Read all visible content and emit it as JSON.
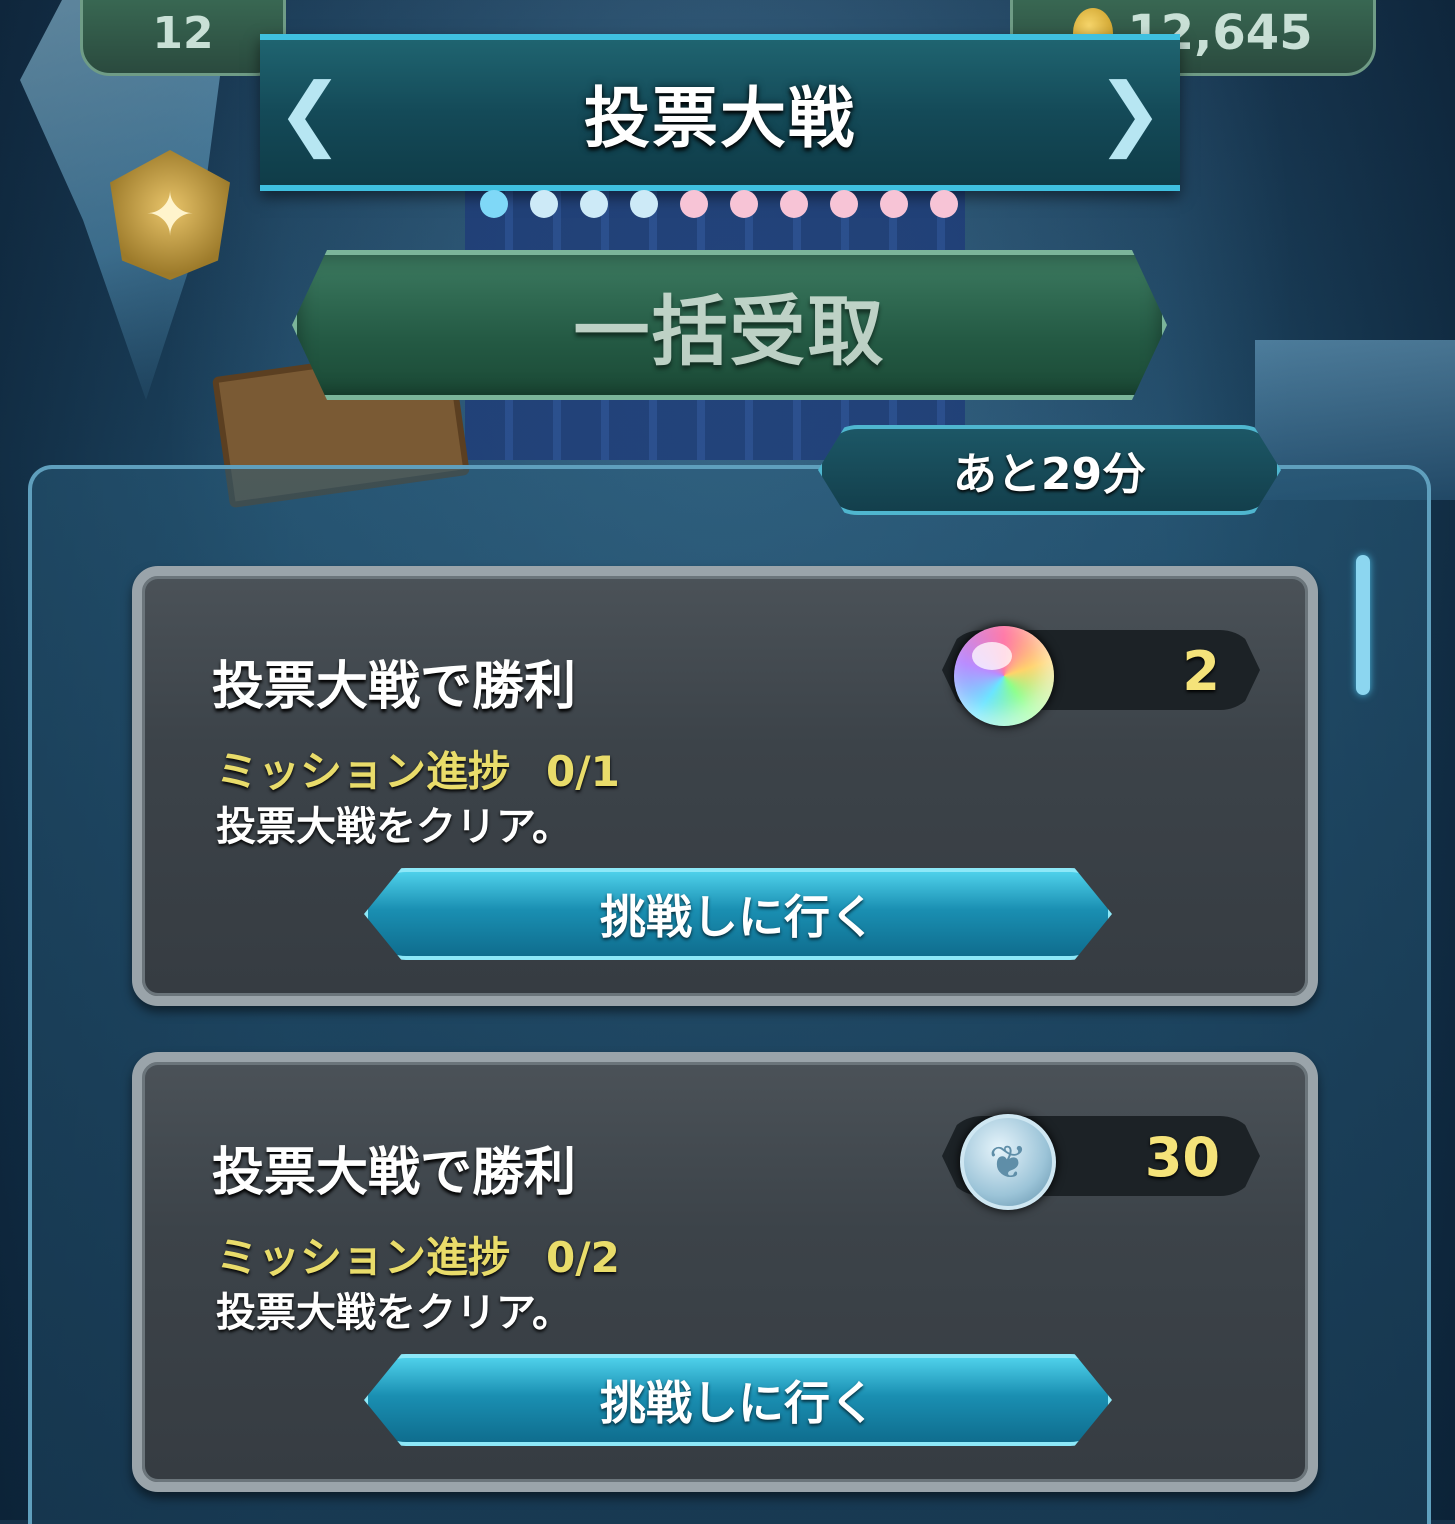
{
  "header": {
    "title": "投票大戦",
    "left_status": "12",
    "right_status": "12,645"
  },
  "pagination": {
    "dots": [
      {
        "color": "#7fd8f7"
      },
      {
        "color": "#cdeaf7"
      },
      {
        "color": "#cdeaf7"
      },
      {
        "color": "#cdeaf7"
      },
      {
        "color": "#f7c4d6"
      },
      {
        "color": "#f7c4d6"
      },
      {
        "color": "#f7c4d6"
      },
      {
        "color": "#f7c4d6"
      },
      {
        "color": "#f7c4d6"
      },
      {
        "color": "#f7c4d6"
      }
    ]
  },
  "bulk_button": {
    "label": "一括受取"
  },
  "timer": {
    "label": "あと29分"
  },
  "missions": [
    {
      "title": "投票大戦で勝利",
      "progress_label": "ミッション進捗",
      "progress": "0/1",
      "description": "投票大戦をクリア。",
      "reward_icon": "orb-icon",
      "reward_amount": "2",
      "button_label": "挑戦しに行く"
    },
    {
      "title": "投票大戦で勝利",
      "progress_label": "ミッション進捗",
      "progress": "0/2",
      "description": "投票大戦をクリア。",
      "reward_icon": "feather-medallion-icon",
      "reward_amount": "30",
      "button_label": "挑戦しに行く"
    }
  ]
}
